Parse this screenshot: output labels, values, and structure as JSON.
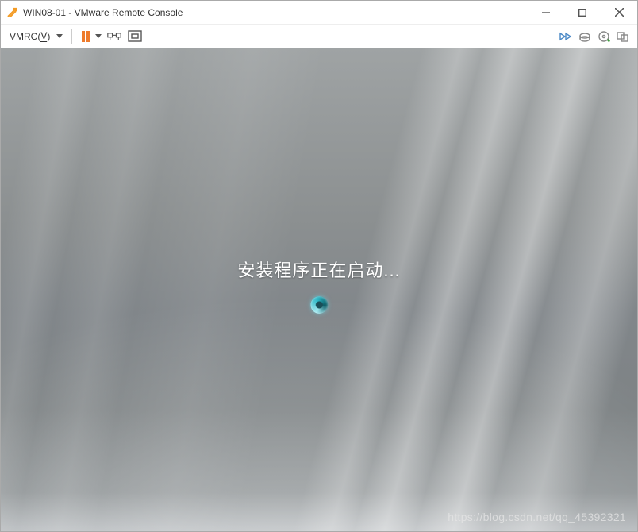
{
  "window": {
    "title": "WIN08-01 - VMware Remote Console"
  },
  "toolbar": {
    "menu_vmrc": "VMRC",
    "menu_vmrc_hotkey": "V"
  },
  "vm": {
    "status_text": "安装程序正在启动..."
  },
  "watermark": "https://blog.csdn.net/qq_45392321"
}
